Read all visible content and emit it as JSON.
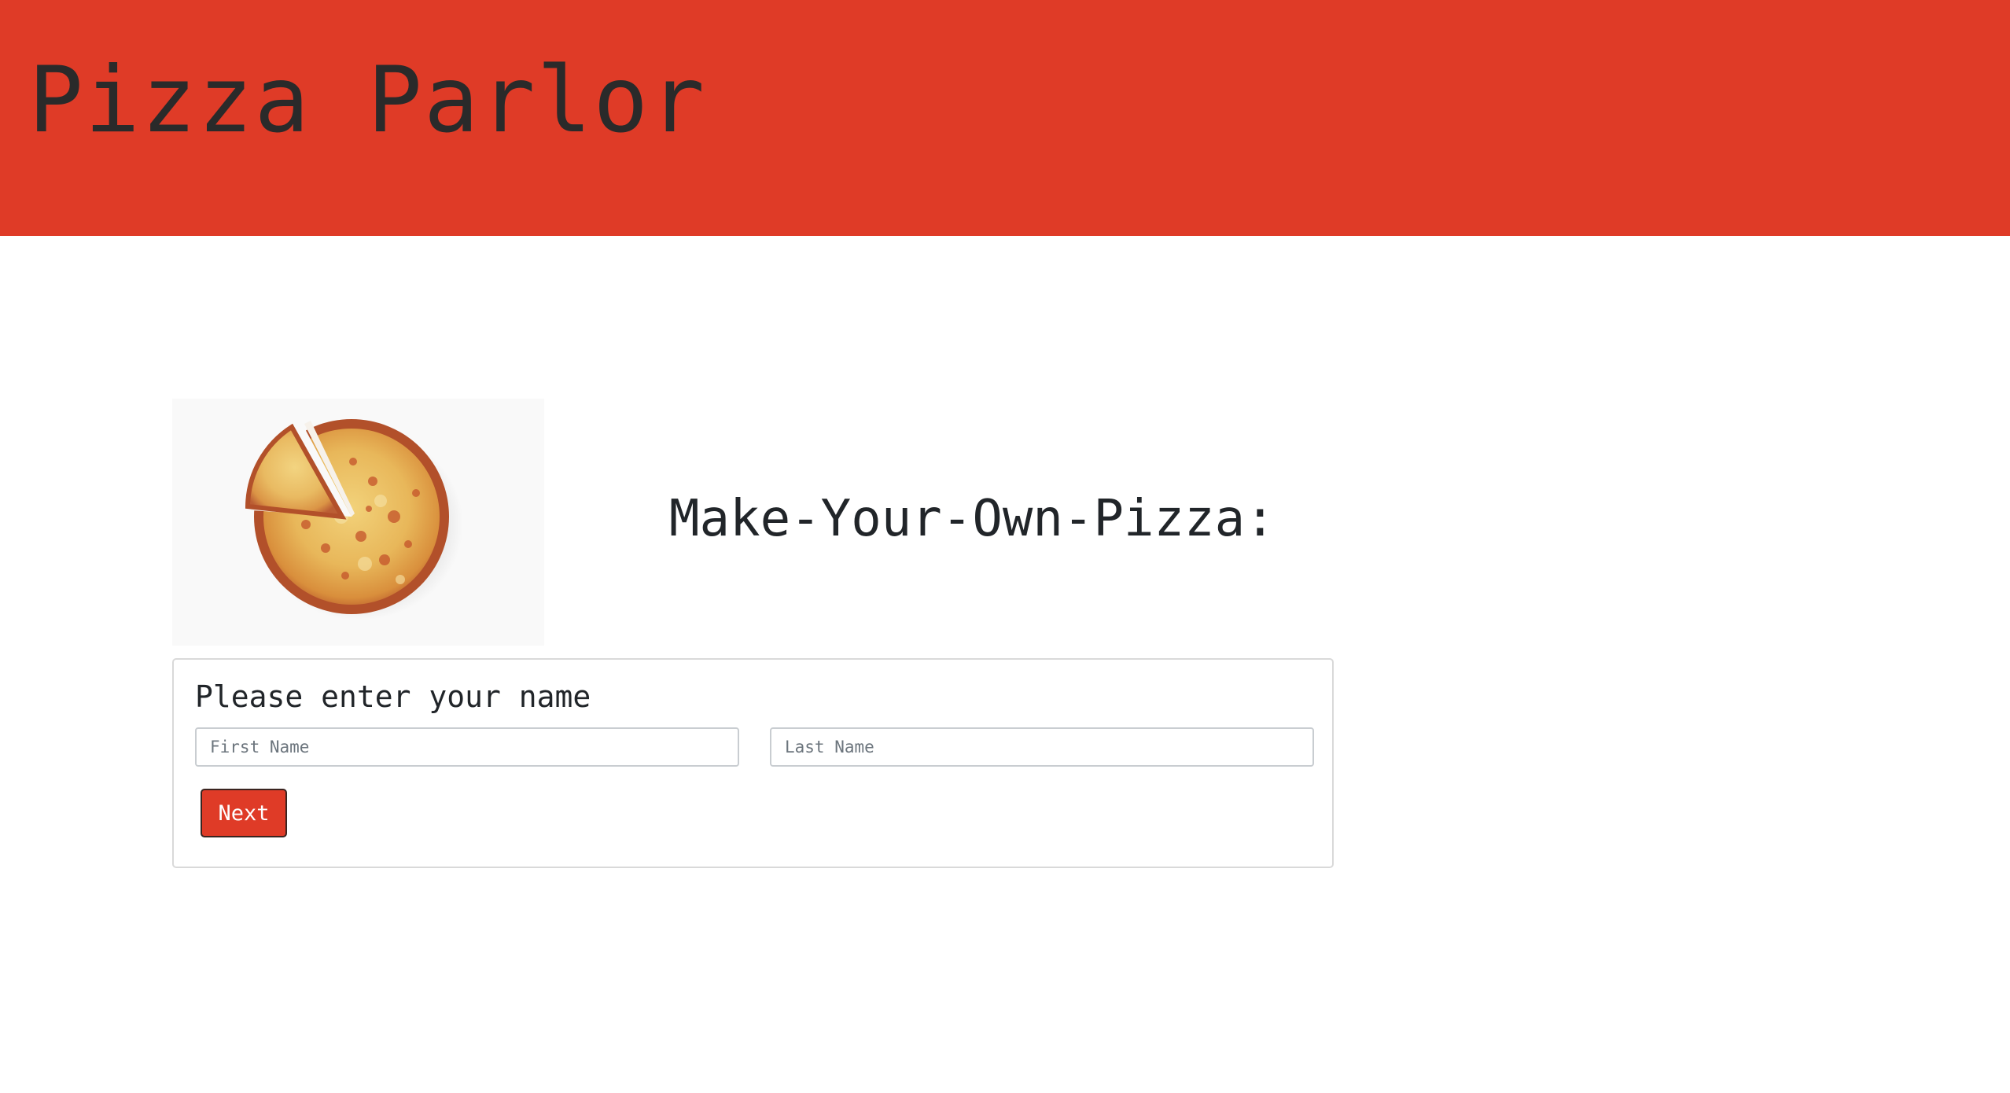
{
  "header": {
    "title": "Pizza Parlor",
    "background_color": "#df3b27"
  },
  "hero": {
    "image_icon": "pizza-image",
    "heading": "Make-Your-Own-Pizza:"
  },
  "name_form": {
    "title": "Please enter your name",
    "first_name": {
      "value": "",
      "placeholder": "First Name"
    },
    "last_name": {
      "value": "",
      "placeholder": "Last Name"
    },
    "next_label": "Next",
    "button_color": "#df3b27"
  }
}
